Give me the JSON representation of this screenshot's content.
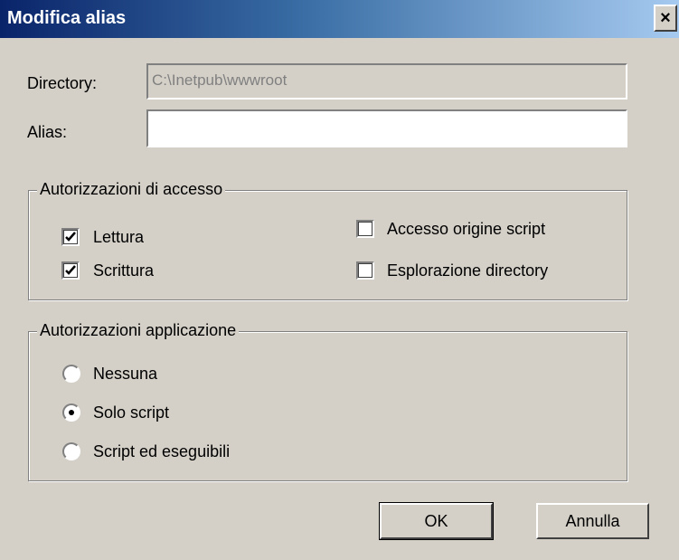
{
  "window": {
    "title": "Modifica alias",
    "close_glyph": "×"
  },
  "directory": {
    "label": "Directory:",
    "value": "C:\\Inetpub\\wwwroot"
  },
  "alias": {
    "label": "Alias:",
    "value": ""
  },
  "access_permissions": {
    "title": "Autorizzazioni di accesso",
    "options": [
      {
        "label": "Lettura",
        "checked": true
      },
      {
        "label": "Scrittura",
        "checked": true
      },
      {
        "label": "Accesso origine script",
        "checked": false
      },
      {
        "label": "Esplorazione directory",
        "checked": false
      }
    ]
  },
  "application_permissions": {
    "title": "Autorizzazioni applicazione",
    "options": [
      {
        "label": "Nessuna",
        "selected": false
      },
      {
        "label": "Solo script",
        "selected": true
      },
      {
        "label": "Script ed eseguibili",
        "selected": false
      }
    ]
  },
  "buttons": {
    "ok": "OK",
    "cancel": "Annulla"
  },
  "colors": {
    "title_bar_start": "#0a246a",
    "title_bar_end": "#a6caf0",
    "dialog_face": "#d4d0c8"
  }
}
